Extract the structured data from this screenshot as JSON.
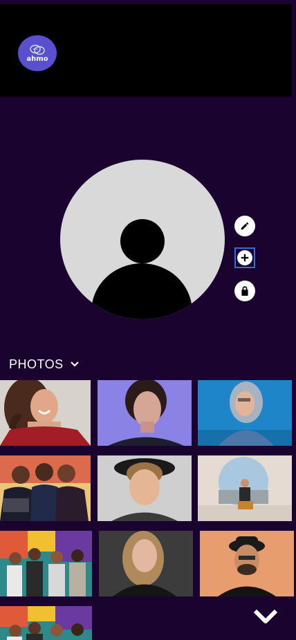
{
  "header": {
    "logo_text": "ahmo"
  },
  "profile": {
    "avatar_alt": "default-avatar",
    "actions": [
      {
        "icon": "pencil-icon",
        "label": "edit"
      },
      {
        "icon": "plus-icon",
        "label": "add"
      },
      {
        "icon": "lock-icon",
        "label": "lock"
      }
    ]
  },
  "photos": {
    "label": "PHOTOS",
    "items": [
      {
        "subject": "woman-red-top-smiling"
      },
      {
        "subject": "woman-blue-light-portrait"
      },
      {
        "subject": "woman-hood-denim-jacket"
      },
      {
        "subject": "group-of-women-event"
      },
      {
        "subject": "man-curly-hair-hat"
      },
      {
        "subject": "man-sitting-round-window"
      },
      {
        "subject": "friends-mural-wall"
      },
      {
        "subject": "woman-dark-blonde-portrait"
      },
      {
        "subject": "man-hat-sunglasses-orange-wall"
      },
      {
        "subject": "friends-mural-wall"
      }
    ]
  },
  "colors": {
    "background": "#1b0330",
    "topbar": "#000000",
    "logo": "#5a4fcf",
    "focus_ring": "#2f6fde"
  }
}
